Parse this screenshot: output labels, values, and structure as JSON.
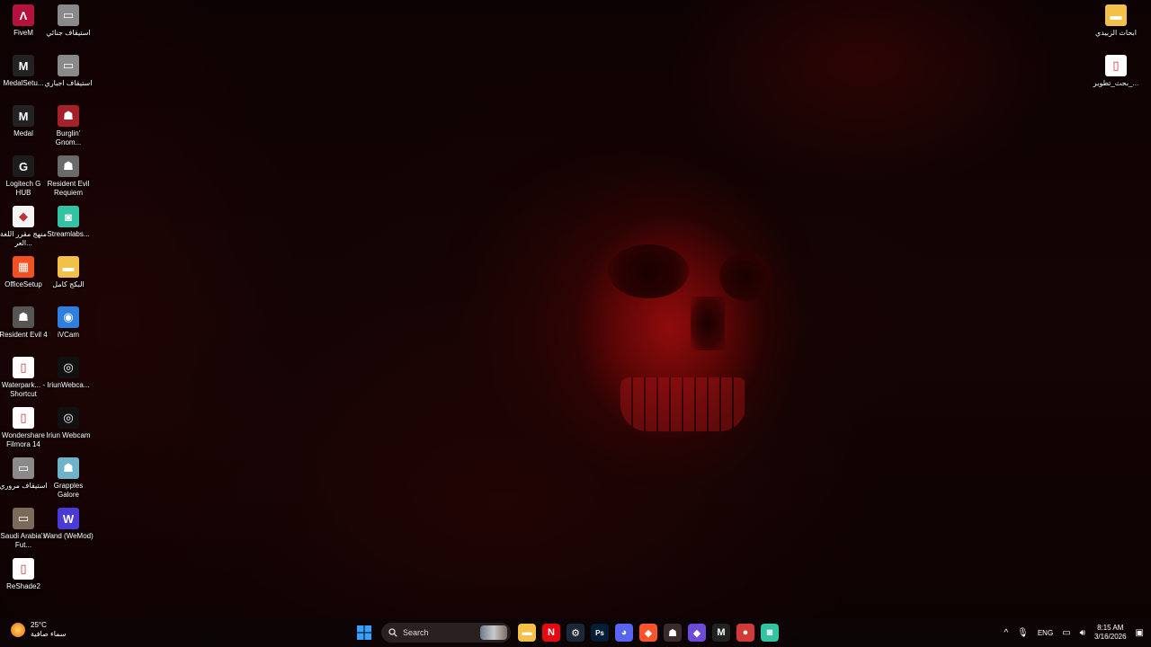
{
  "desktop": {
    "left_icons": [
      {
        "label": "FiveM",
        "icon": "fivem-icon",
        "color": "#b3123c",
        "glyph": "Λ"
      },
      {
        "label": "استيقاف جنائي",
        "icon": "image-thumbnail-icon",
        "color": "#8a8a8a",
        "glyph": "▭"
      },
      {
        "label": "MedalSetu...",
        "icon": "medal-setup-icon",
        "color": "#222222",
        "glyph": "M"
      },
      {
        "label": "استيقاف اجباري",
        "icon": "image-thumbnail-icon",
        "color": "#8a8a8a",
        "glyph": "▭"
      },
      {
        "label": "Medal",
        "icon": "medal-icon",
        "color": "#222222",
        "glyph": "M"
      },
      {
        "label": "Burglin' Gnom...",
        "icon": "burglin-gnomes-icon",
        "color": "#a3212b",
        "glyph": "☗"
      },
      {
        "label": "Logitech G HUB",
        "icon": "logitech-ghub-icon",
        "color": "#1c1c1c",
        "glyph": "G"
      },
      {
        "label": "Resident Evil Requiem",
        "icon": "resident-evil-requiem-icon",
        "color": "#6a6a6a",
        "glyph": "☗"
      },
      {
        "label": "منهج مقرر اللغة العر...",
        "icon": "brave-pdf-icon",
        "color": "#f4f4f4",
        "glyph": "◆"
      },
      {
        "label": "Streamlabs...",
        "icon": "streamlabs-icon",
        "color": "#31c3a2",
        "glyph": "◙"
      },
      {
        "label": "OfficeSetup",
        "icon": "office-setup-icon",
        "color": "#f25022",
        "glyph": "▦"
      },
      {
        "label": "البكج كامل",
        "icon": "folder-icon",
        "color": "#f3c04a",
        "glyph": "▬"
      },
      {
        "label": "Resident Evil 4",
        "icon": "resident-evil-4-icon",
        "color": "#555555",
        "glyph": "☗"
      },
      {
        "label": "iVCam",
        "icon": "ivcam-icon",
        "color": "#2f7fe0",
        "glyph": "◉"
      },
      {
        "label": "Waterpark... - Shortcut",
        "icon": "document-shortcut-icon",
        "color": "#ffffff",
        "glyph": "▯"
      },
      {
        "label": "IriunWebca...",
        "icon": "iriun-webcam-icon",
        "color": "#111111",
        "glyph": "◎"
      },
      {
        "label": "Wondershare Filmora 14",
        "icon": "document-icon",
        "color": "#ffffff",
        "glyph": "▯"
      },
      {
        "label": "Iriun Webcam",
        "icon": "iriun-webcam-icon",
        "color": "#111111",
        "glyph": "◎"
      },
      {
        "label": "استيقاف مروري",
        "icon": "image-thumbnail-icon",
        "color": "#8a8a8a",
        "glyph": "▭"
      },
      {
        "label": "Grapples Galore",
        "icon": "grapples-galore-icon",
        "color": "#6fb3c9",
        "glyph": "☗"
      },
      {
        "label": "Saudi Arabia's Fut...",
        "icon": "image-thumbnail-icon",
        "color": "#7a6a5a",
        "glyph": "▭"
      },
      {
        "label": "Wand (WeMod)",
        "icon": "wand-wemod-icon",
        "color": "#4b3bd6",
        "glyph": "W"
      },
      {
        "label": "ReShade2",
        "icon": "document-icon",
        "color": "#ffffff",
        "glyph": "▯"
      }
    ],
    "right_icons": [
      {
        "label": "ابحاث الزبيدي",
        "icon": "folder-icon",
        "color": "#f3c04a",
        "glyph": "▬"
      },
      {
        "label": "بحث_تطوير_...",
        "icon": "document-icon",
        "color": "#ffffff",
        "glyph": "▯"
      }
    ]
  },
  "taskbar": {
    "weather": {
      "temp": "25°C",
      "condition": "سماء صافية"
    },
    "search_placeholder": "Search",
    "apps": [
      {
        "name": "file-explorer-icon",
        "color": "#f3c04a",
        "glyph": "▬"
      },
      {
        "name": "netflix-icon",
        "color": "#e50914",
        "glyph": "N"
      },
      {
        "name": "steam-icon",
        "color": "#1b2838",
        "glyph": "⚙"
      },
      {
        "name": "photoshop-icon",
        "color": "#001e36",
        "glyph": "Ps"
      },
      {
        "name": "discord-icon",
        "color": "#5865f2",
        "glyph": "◕"
      },
      {
        "name": "brave-icon",
        "color": "#fb542b",
        "glyph": "◆"
      },
      {
        "name": "game-app-icon",
        "color": "#3a2a2a",
        "glyph": "☗"
      },
      {
        "name": "app-diamond-icon",
        "color": "#6d4bd8",
        "glyph": "◆"
      },
      {
        "name": "medal-icon",
        "color": "#222222",
        "glyph": "M"
      },
      {
        "name": "app-red-icon",
        "color": "#d23a3a",
        "glyph": "●"
      },
      {
        "name": "streamlabs-icon",
        "color": "#31c3a2",
        "glyph": "◙"
      }
    ],
    "tray": {
      "language": "ENG",
      "time": "8:15 AM",
      "date": "3/16/2026"
    }
  }
}
